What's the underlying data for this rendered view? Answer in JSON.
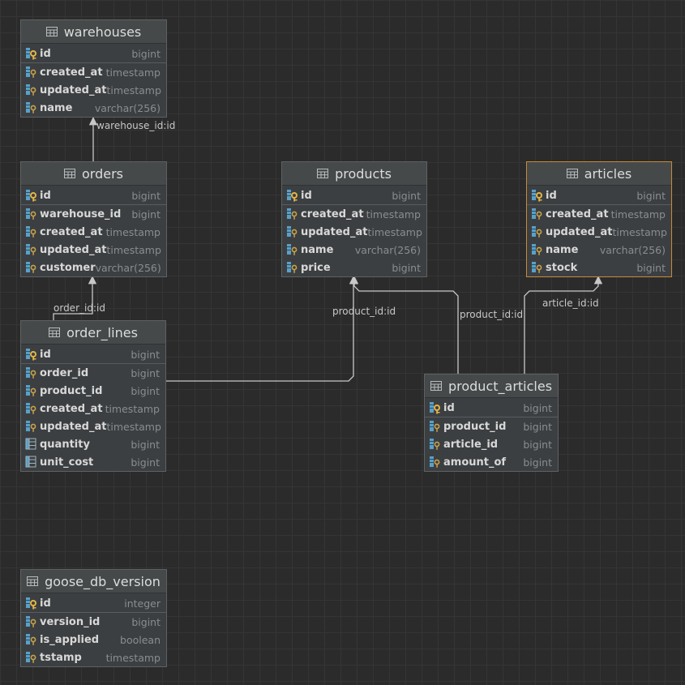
{
  "entities": [
    {
      "key": "warehouses",
      "title": "warehouses",
      "selected": false,
      "columns": [
        {
          "name": "id",
          "type": "bigint",
          "kind": "pk"
        },
        {
          "name": "created_at",
          "type": "timestamp",
          "kind": "col"
        },
        {
          "name": "updated_at",
          "type": "timestamp",
          "kind": "col"
        },
        {
          "name": "name",
          "type": "varchar(256)",
          "kind": "col"
        }
      ]
    },
    {
      "key": "orders",
      "title": "orders",
      "selected": false,
      "columns": [
        {
          "name": "id",
          "type": "bigint",
          "kind": "pk"
        },
        {
          "name": "warehouse_id",
          "type": "bigint",
          "kind": "col"
        },
        {
          "name": "created_at",
          "type": "timestamp",
          "kind": "col"
        },
        {
          "name": "updated_at",
          "type": "timestamp",
          "kind": "col"
        },
        {
          "name": "customer",
          "type": "varchar(256)",
          "kind": "col"
        }
      ]
    },
    {
      "key": "products",
      "title": "products",
      "selected": false,
      "columns": [
        {
          "name": "id",
          "type": "bigint",
          "kind": "pk"
        },
        {
          "name": "created_at",
          "type": "timestamp",
          "kind": "col"
        },
        {
          "name": "updated_at",
          "type": "timestamp",
          "kind": "col"
        },
        {
          "name": "name",
          "type": "varchar(256)",
          "kind": "col"
        },
        {
          "name": "price",
          "type": "bigint",
          "kind": "col"
        }
      ]
    },
    {
      "key": "articles",
      "title": "articles",
      "selected": true,
      "columns": [
        {
          "name": "id",
          "type": "bigint",
          "kind": "pk"
        },
        {
          "name": "created_at",
          "type": "timestamp",
          "kind": "col"
        },
        {
          "name": "updated_at",
          "type": "timestamp",
          "kind": "col"
        },
        {
          "name": "name",
          "type": "varchar(256)",
          "kind": "col"
        },
        {
          "name": "stock",
          "type": "bigint",
          "kind": "col"
        }
      ]
    },
    {
      "key": "order_lines",
      "title": "order_lines",
      "selected": false,
      "columns": [
        {
          "name": "id",
          "type": "bigint",
          "kind": "pk"
        },
        {
          "name": "order_id",
          "type": "bigint",
          "kind": "col"
        },
        {
          "name": "product_id",
          "type": "bigint",
          "kind": "col"
        },
        {
          "name": "created_at",
          "type": "timestamp",
          "kind": "col"
        },
        {
          "name": "updated_at",
          "type": "timestamp",
          "kind": "col"
        },
        {
          "name": "quantity",
          "type": "bigint",
          "kind": "plain"
        },
        {
          "name": "unit_cost",
          "type": "bigint",
          "kind": "plain"
        }
      ]
    },
    {
      "key": "product_articles",
      "title": "product_articles",
      "selected": false,
      "columns": [
        {
          "name": "id",
          "type": "bigint",
          "kind": "pk"
        },
        {
          "name": "product_id",
          "type": "bigint",
          "kind": "col"
        },
        {
          "name": "article_id",
          "type": "bigint",
          "kind": "col"
        },
        {
          "name": "amount_of",
          "type": "bigint",
          "kind": "col"
        }
      ]
    },
    {
      "key": "goose_db_version",
      "title": "goose_db_version",
      "selected": false,
      "columns": [
        {
          "name": "id",
          "type": "integer",
          "kind": "pk"
        },
        {
          "name": "version_id",
          "type": "bigint",
          "kind": "col"
        },
        {
          "name": "is_applied",
          "type": "boolean",
          "kind": "col"
        },
        {
          "name": "tstamp",
          "type": "timestamp",
          "kind": "col"
        }
      ]
    }
  ],
  "relations": [
    {
      "from": "orders",
      "to": "warehouses",
      "label": "warehouse_id:id"
    },
    {
      "from": "order_lines",
      "to": "orders",
      "label": "order_id:id"
    },
    {
      "from": "order_lines",
      "to": "products",
      "label": "product_id:id"
    },
    {
      "from": "product_articles",
      "to": "products",
      "label": "product_id:id"
    },
    {
      "from": "product_articles",
      "to": "articles",
      "label": "article_id:id"
    }
  ],
  "colors": {
    "background": "#2b2b2b",
    "entity": "#3c3f41",
    "selected_border": "#c98a3a",
    "edge": "#c8c8c8",
    "key_gold": "#e3b447",
    "key_blue": "#5aa0c8"
  },
  "icons": {
    "table": "table-icon",
    "primary_key": "primary-key-icon",
    "column": "column-key-icon",
    "plain": "column-icon"
  }
}
